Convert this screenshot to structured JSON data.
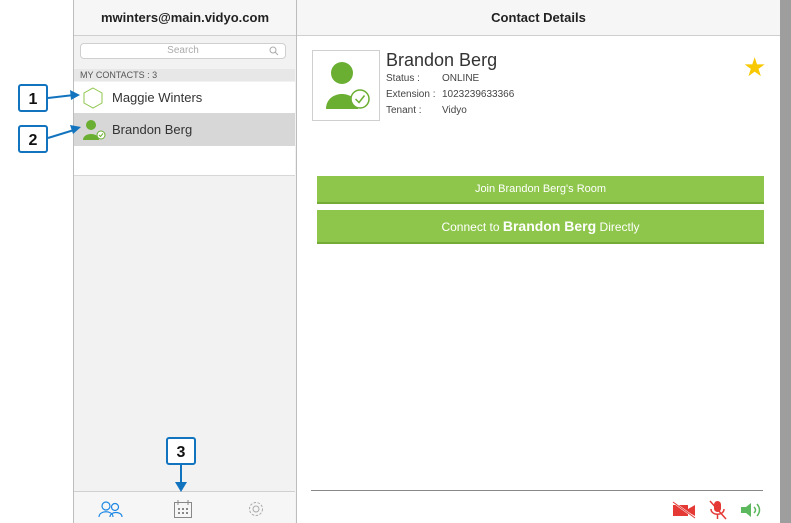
{
  "left_header": "mwinters@main.vidyo.com",
  "right_header": "Contact Details",
  "search": {
    "placeholder": "Search"
  },
  "contacts_header": "MY CONTACTS : 3",
  "contacts": [
    {
      "name": "Maggie Winters",
      "status": "offline"
    },
    {
      "name": "Brandon Berg",
      "status": "online",
      "selected": true
    }
  ],
  "detail": {
    "name": "Brandon Berg",
    "status_label": "Status :",
    "status_value": "ONLINE",
    "extension_label": "Extension :",
    "extension_value": "1023239633366",
    "tenant_label": "Tenant :",
    "tenant_value": "Vidyo",
    "favorite": true
  },
  "actions": {
    "join_room": "Join Brandon Berg's Room",
    "connect_prefix": "Connect to",
    "connect_name": "Brandon Berg",
    "connect_suffix": "Directly"
  },
  "callouts": [
    "1",
    "2",
    "3"
  ],
  "icons": {
    "contacts_tab": "contacts-icon",
    "calendar_tab": "calendar-icon",
    "settings_tab": "gear-icon",
    "camera": "camera-off-icon",
    "mic": "mic-off-icon",
    "speaker": "speaker-on-icon"
  },
  "colors": {
    "accent": "#8dc64a",
    "callout": "#1273be",
    "muted": "#e53935",
    "star": "#f8c800"
  }
}
